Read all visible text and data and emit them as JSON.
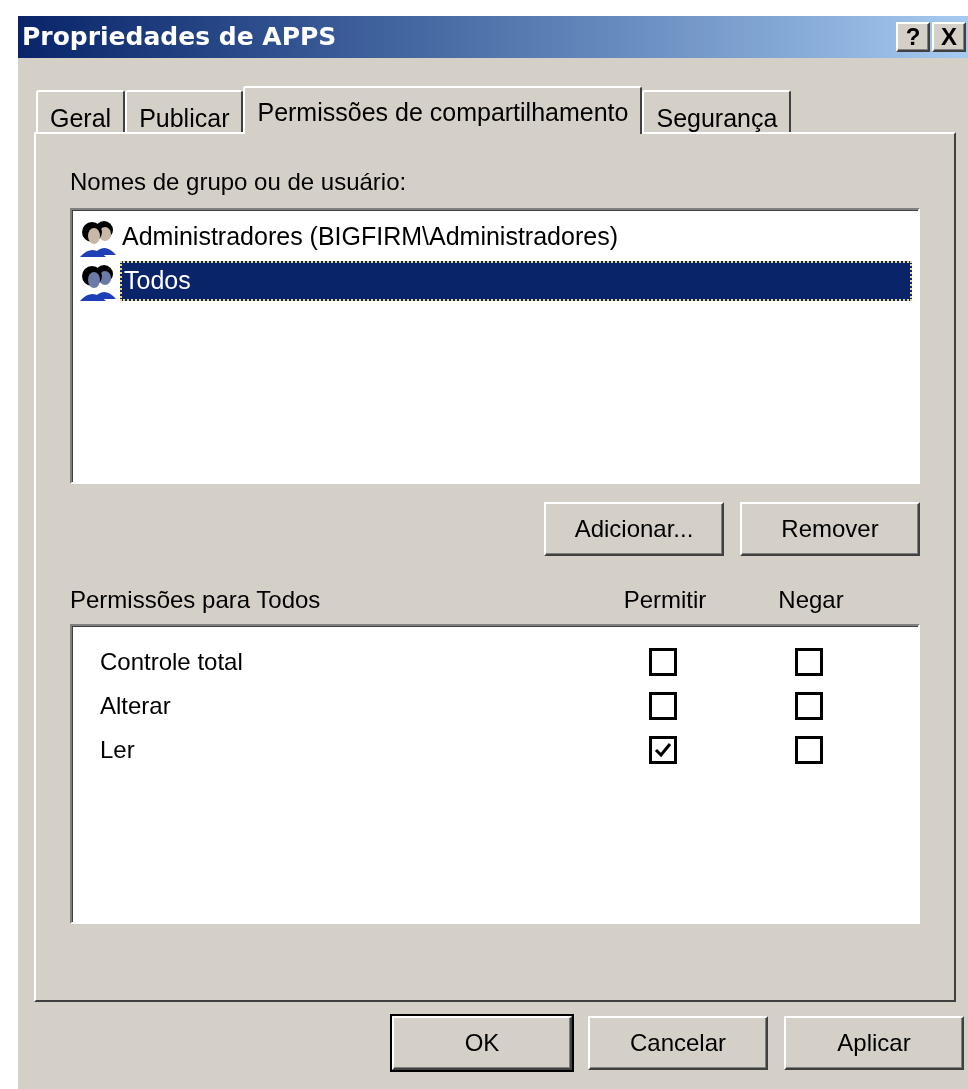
{
  "window": {
    "title": "Propriedades de APPS",
    "title_buttons": [
      "?",
      "X"
    ]
  },
  "tabs": [
    {
      "label": "Geral",
      "selected": false
    },
    {
      "label": "Publicar",
      "selected": false
    },
    {
      "label": "Permissões de compartilhamento",
      "selected": true
    },
    {
      "label": "Segurança",
      "selected": false
    }
  ],
  "users": {
    "label": "Nomes de grupo ou de usuário:",
    "items": [
      {
        "name": "Administradores (BIGFIRM\\Administradores)",
        "selected": false
      },
      {
        "name": "Todos",
        "selected": true
      }
    ],
    "buttons": [
      "Adicionar...",
      "Remover"
    ]
  },
  "permissions": {
    "label": "Permissões para Todos",
    "columns": [
      "Permitir",
      "Negar"
    ],
    "rows": [
      {
        "name": "Controle total",
        "allow": false,
        "deny": false
      },
      {
        "name": "Alterar",
        "allow": false,
        "deny": false
      },
      {
        "name": "Ler",
        "allow": true,
        "deny": false
      }
    ]
  },
  "buttons": [
    {
      "label": "OK",
      "default": true
    },
    {
      "label": "Cancelar",
      "default": false
    },
    {
      "label": "Aplicar",
      "default": false
    }
  ]
}
